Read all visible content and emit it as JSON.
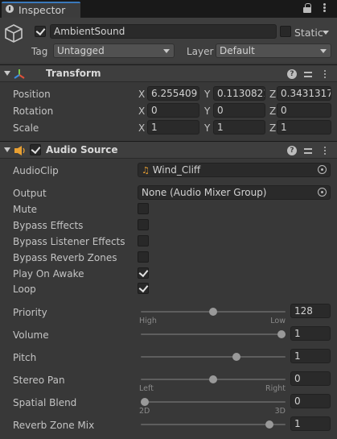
{
  "tab": {
    "label": "Inspector"
  },
  "gameobject": {
    "name": "AmbientSound",
    "active": true,
    "static_label": "Static",
    "static": false,
    "tag_label": "Tag",
    "tag_value": "Untagged",
    "layer_label": "Layer",
    "layer_value": "Default"
  },
  "transform": {
    "title": "Transform",
    "rows": [
      {
        "label": "Position",
        "x": "6.255409",
        "y": "0.1130821",
        "z": "0.3431317"
      },
      {
        "label": "Rotation",
        "x": "0",
        "y": "0",
        "z": "0"
      },
      {
        "label": "Scale",
        "x": "1",
        "y": "1",
        "z": "1"
      }
    ],
    "axis_x": "X",
    "axis_y": "Y",
    "axis_z": "Z"
  },
  "audio": {
    "title": "Audio Source",
    "enabled": true,
    "audioclip_label": "AudioClip",
    "audioclip_value": "Wind_Cliff",
    "output_label": "Output",
    "output_value": "None (Audio Mixer Group)",
    "toggles": [
      {
        "label": "Mute",
        "checked": false
      },
      {
        "label": "Bypass Effects",
        "checked": false
      },
      {
        "label": "Bypass Listener Effects",
        "checked": false
      },
      {
        "label": "Bypass Reverb Zones",
        "checked": false
      },
      {
        "label": "Play On Awake",
        "checked": true
      },
      {
        "label": "Loop",
        "checked": true
      }
    ],
    "sliders": [
      {
        "label": "Priority",
        "value": "128",
        "fraction": 0.5,
        "min_label": "High",
        "max_label": "Low"
      },
      {
        "label": "Volume",
        "value": "1",
        "fraction": 1.0,
        "min_label": "",
        "max_label": ""
      },
      {
        "label": "Pitch",
        "value": "1",
        "fraction": 0.67,
        "min_label": "",
        "max_label": ""
      },
      {
        "label": "Stereo Pan",
        "value": "0",
        "fraction": 0.5,
        "min_label": "Left",
        "max_label": "Right"
      },
      {
        "label": "Spatial Blend",
        "value": "0",
        "fraction": 0.0,
        "min_label": "2D",
        "max_label": "3D"
      },
      {
        "label": "Reverb Zone Mix",
        "value": "1",
        "fraction": 0.91,
        "min_label": "",
        "max_label": ""
      }
    ]
  }
}
